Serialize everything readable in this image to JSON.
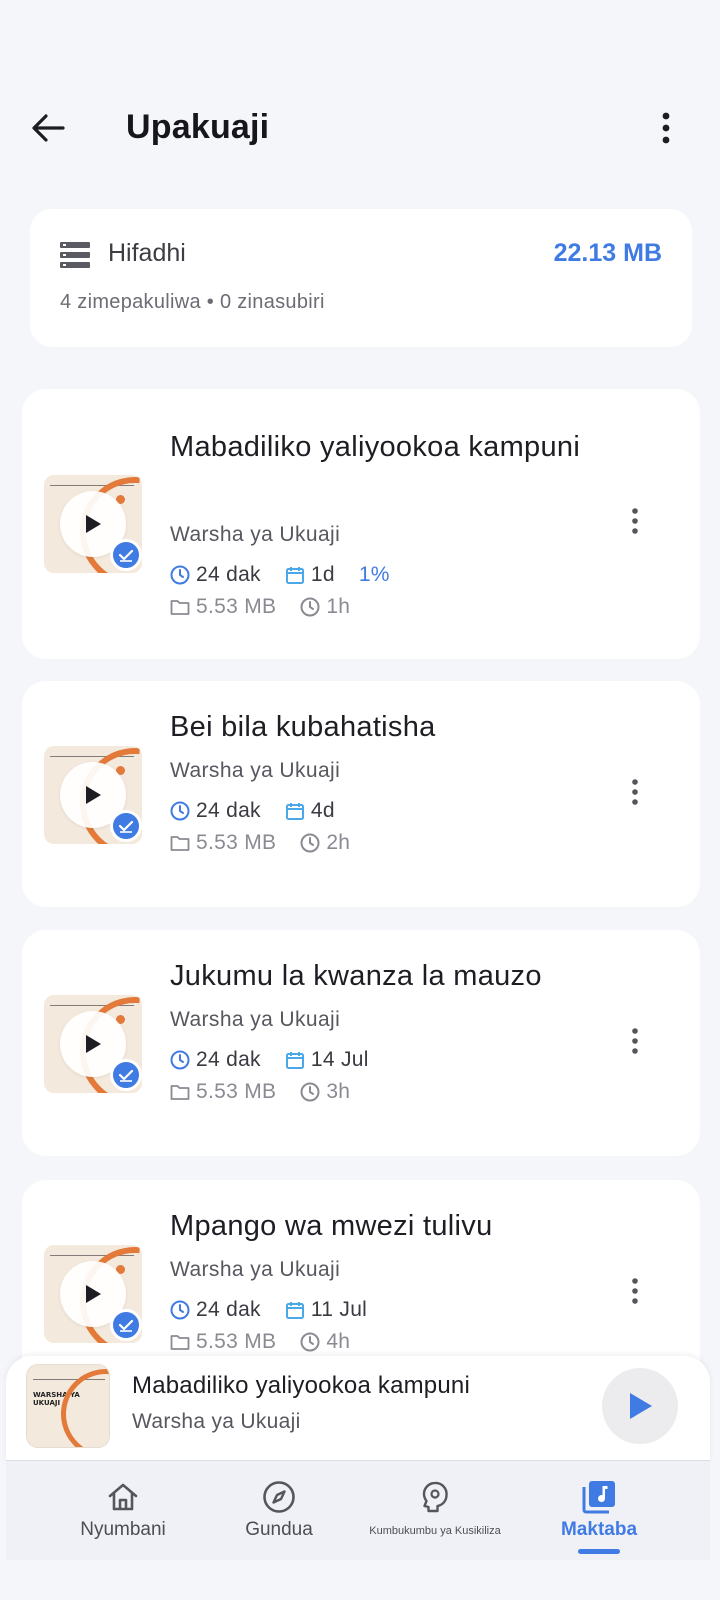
{
  "header": {
    "title": "Upakuaji"
  },
  "storage": {
    "label": "Hifadhi",
    "total_size": "22.13 MB",
    "stats": "4 zimepakuliwa • 0 zinasubiri"
  },
  "downloads": [
    {
      "title": "Mabadiliko yaliyookoa kampuni",
      "subtitle": "Warsha ya Ukuaji",
      "duration": "24 dak",
      "date": "1d",
      "progress": "1%",
      "size": "5.53 MB",
      "time": "1h"
    },
    {
      "title": "Bei bila kubahatisha",
      "subtitle": "Warsha ya Ukuaji",
      "duration": "24 dak",
      "date": "4d",
      "size": "5.53 MB",
      "time": "2h"
    },
    {
      "title": "Jukumu la kwanza la mauzo",
      "subtitle": "Warsha ya Ukuaji",
      "duration": "24 dak",
      "date": "14 Jul",
      "size": "5.53 MB",
      "time": "3h"
    },
    {
      "title": "Mpango wa mwezi tulivu",
      "subtitle": "Warsha ya Ukuaji",
      "duration": "24 dak",
      "date": "11 Jul",
      "size": "5.53 MB",
      "time": "4h"
    }
  ],
  "mini_player": {
    "thumb_text": "WARSHA YA UKUAJI",
    "title": "Mabadiliko yaliyookoa kampuni",
    "subtitle": "Warsha ya Ukuaji"
  },
  "nav": [
    {
      "label": "Nyumbani",
      "icon": "home-icon"
    },
    {
      "label": "Gundua",
      "icon": "compass-icon"
    },
    {
      "label": "Kumbukumbu ya Kusikiliza",
      "icon": "brain-icon"
    },
    {
      "label": "Maktaba",
      "icon": "library-music-icon"
    }
  ],
  "colors": {
    "accent": "#3f7be3",
    "thumb_orange": "#e37a3a",
    "background": "#f5f6fa"
  }
}
